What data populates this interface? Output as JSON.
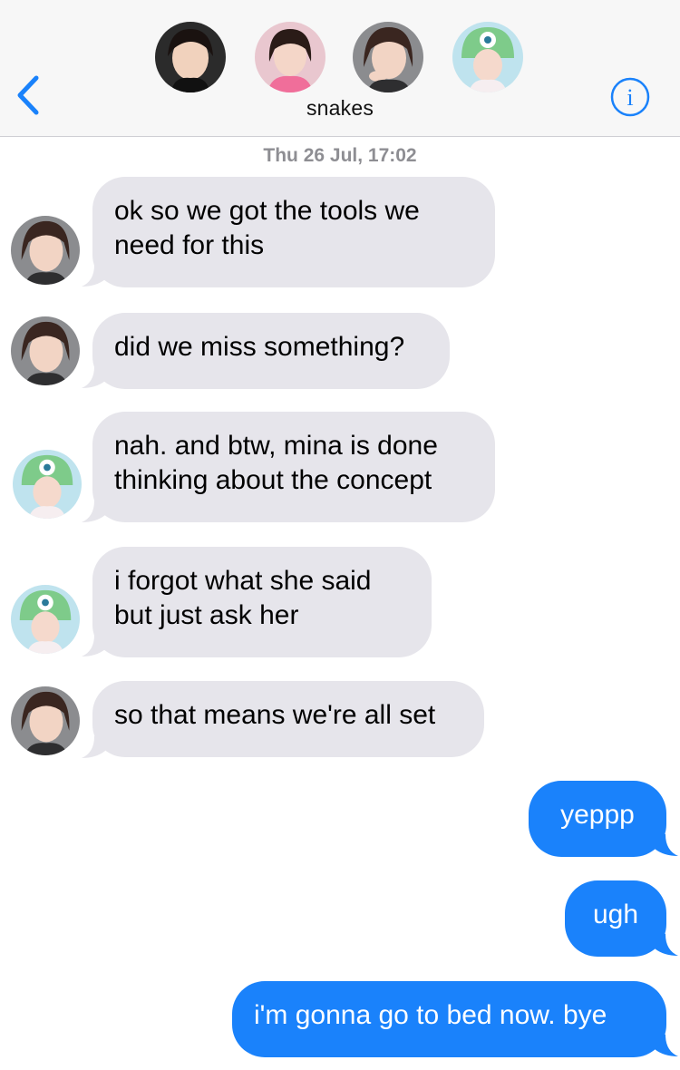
{
  "header": {
    "group_name": "snakes",
    "back_icon": "chevron-left-icon",
    "info_icon": "info-icon",
    "accent": "#1a82fb",
    "participants": [
      {
        "avatar": "avatar-1"
      },
      {
        "avatar": "avatar-2"
      },
      {
        "avatar": "avatar-3"
      },
      {
        "avatar": "avatar-4"
      }
    ]
  },
  "timestamp": "Thu 26 Jul, 17:02",
  "messages": [
    {
      "direction": "incoming",
      "text": "ok so we got the tools we\nneed for this"
    },
    {
      "direction": "incoming",
      "text": "did we miss something?"
    },
    {
      "direction": "incoming",
      "text": "nah. and btw, mina is done\nthinking about the concept"
    },
    {
      "direction": "incoming",
      "text": "i forgot what she said\nbut just ask her"
    },
    {
      "direction": "incoming",
      "text": "so that means we're all set"
    },
    {
      "direction": "outgoing",
      "text": "yeppp"
    },
    {
      "direction": "outgoing",
      "text": "ugh"
    },
    {
      "direction": "outgoing",
      "text": "i'm gonna go to bed now. bye"
    }
  ],
  "colors": {
    "incoming_bubble": "#e6e5eb",
    "outgoing_bubble": "#1a82fb",
    "header_bg": "#f7f7f7",
    "timestamp": "#8e8e93"
  }
}
